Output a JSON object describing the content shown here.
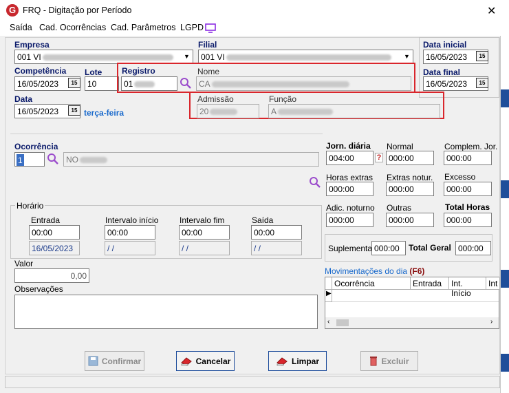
{
  "window": {
    "title": "FRQ - Digitação por Período",
    "logo": "G"
  },
  "menu": {
    "items": [
      "Saída",
      "Cad. Ocorrências",
      "Cad. Parâmetros",
      "LGPD"
    ]
  },
  "fields": {
    "empresa_label": "Empresa",
    "empresa_value": "001 VI",
    "filial_label": "Filial",
    "filial_value": "001 VI",
    "data_inicial_label": "Data inicial",
    "data_inicial_value": "16/05/2023",
    "data_final_label": "Data final",
    "data_final_value": "16/05/2023",
    "competencia_label": "Competência",
    "competencia_value": "16/05/2023",
    "lote_label": "Lote",
    "lote_value": "10",
    "registro_label": "Registro",
    "registro_value": "01",
    "nome_label": "Nome",
    "nome_value": "CA",
    "data_label": "Data",
    "data_value": "16/05/2023",
    "weekday": "terça-feira",
    "admissao_label": "Admissão",
    "admissao_value": "20",
    "funcao_label": "Função",
    "funcao_value": "A"
  },
  "ocorrencia": {
    "label": "Ocorrência",
    "code": "1",
    "desc": "NO"
  },
  "horario": {
    "group_label": "Horário",
    "entrada_label": "Entrada",
    "entrada_value": "00:00",
    "entrada_date": "16/05/2023",
    "int_inicio_label": "Intervalo início",
    "int_inicio_value": "00:00",
    "int_inicio_date": " / /",
    "int_fim_label": "Intervalo fim",
    "int_fim_value": "00:00",
    "int_fim_date": " / /",
    "saida_label": "Saída",
    "saida_value": "00:00",
    "saida_date": " / /"
  },
  "valor": {
    "label": "Valor",
    "value": "0,00"
  },
  "observacoes": {
    "label": "Observações",
    "value": ""
  },
  "hours": {
    "jorn_diaria_label": "Jorn. diária",
    "jorn_diaria_value": "004:00",
    "jorn_help": "?",
    "normal_label": "Normal",
    "normal_value": "000:00",
    "complem_label": "Complem. Jor.",
    "complem_value": "000:00",
    "horas_extras_label": "Horas extras",
    "horas_extras_value": "000:00",
    "extras_notur_label": "Extras notur.",
    "extras_notur_value": "000:00",
    "excesso_label": "Excesso",
    "excesso_value": "000:00",
    "adic_noturno_label": "Adic. noturno",
    "adic_noturno_value": "000:00",
    "outras_label": "Outras",
    "outras_value": "000:00",
    "total_horas_label": "Total Horas",
    "total_horas_value": "000:00",
    "suplementar_label": "Suplementar",
    "suplementar_value": "000:00",
    "total_geral_label": "Total Geral",
    "total_geral_value": "000:00"
  },
  "movimentacoes": {
    "title": "Movimentações do dia",
    "shortcut": "(F6)",
    "columns": [
      "Ocorrência",
      "Entrada",
      "Int. Início",
      "Int"
    ]
  },
  "buttons": {
    "confirmar": "Confirmar",
    "cancelar": "Cancelar",
    "limpar": "Limpar",
    "excluir": "Excluir"
  },
  "colors": {
    "label_blue": "#0a1a6a",
    "highlight_red": "#d9262c",
    "weekday_blue": "#1a6acc"
  }
}
